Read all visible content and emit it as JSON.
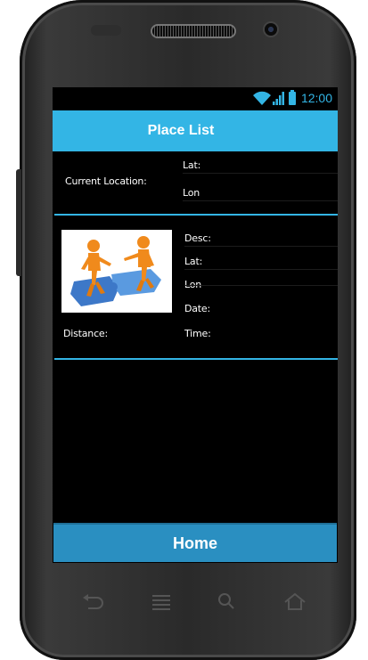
{
  "status_bar": {
    "time": "12:00",
    "icons": [
      "wifi-icon",
      "signal-icon",
      "battery-icon"
    ]
  },
  "header": {
    "title": "Place List"
  },
  "current_location": {
    "label": "Current Location:",
    "lat_label": "Lat:",
    "lon_label": "Lon"
  },
  "place_item": {
    "image": "team-puzzle-figures",
    "desc_label": "Desc:",
    "lat_label": "Lat:",
    "lon_label": "Lon",
    "date_label": "Date:",
    "time_label": "Time:",
    "distance_label": "Distance:"
  },
  "footer": {
    "home_label": "Home"
  },
  "device_keys": [
    "back-icon",
    "menu-icon",
    "search-icon",
    "home-icon"
  ],
  "colors": {
    "accent": "#33b5e5",
    "button": "#2a8fc1",
    "background": "#000000",
    "text": "#ffffff"
  }
}
